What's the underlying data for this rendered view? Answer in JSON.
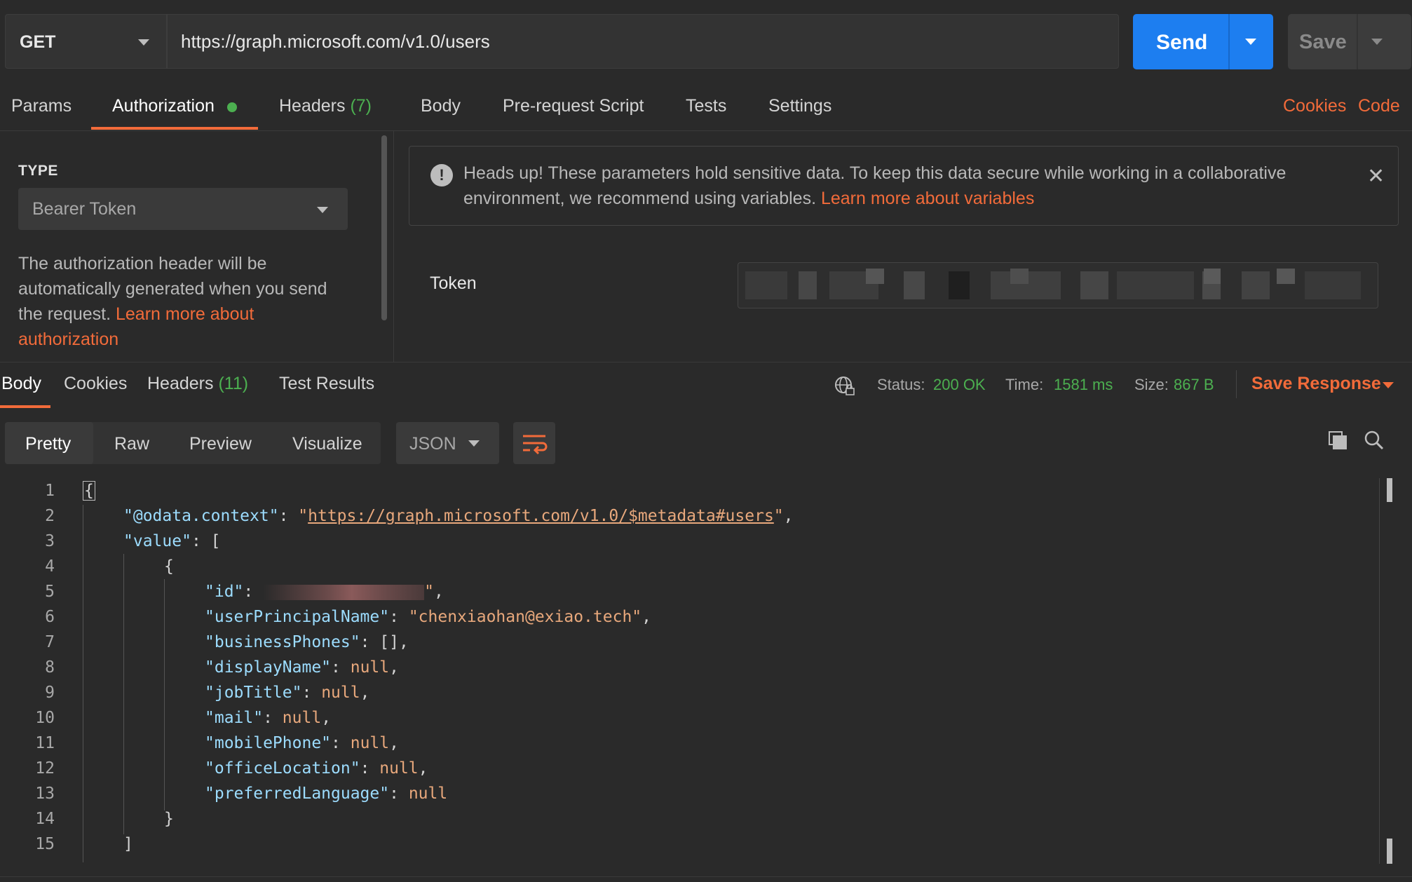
{
  "request": {
    "method": "GET",
    "url": "https://graph.microsoft.com/v1.0/users",
    "send_label": "Send",
    "save_label": "Save"
  },
  "request_tabs": [
    {
      "label": "Params"
    },
    {
      "label": "Authorization",
      "active": true
    },
    {
      "label": "Headers",
      "count": "(7)"
    },
    {
      "label": "Body"
    },
    {
      "label": "Pre-request Script"
    },
    {
      "label": "Tests"
    },
    {
      "label": "Settings"
    }
  ],
  "links": {
    "cookies": "Cookies",
    "code": "Code"
  },
  "auth": {
    "type_label": "TYPE",
    "type_value": "Bearer Token",
    "description": "The authorization header will be automatically generated when you send the request.",
    "description_link": "Learn more about authorization",
    "warning_text": "Heads up! These parameters hold sensitive data. To keep this data secure while working in a collaborative environment, we recommend using variables.",
    "warning_link": "Learn more about variables",
    "token_label": "Token"
  },
  "response_tabs": [
    {
      "label": "Body",
      "active": true
    },
    {
      "label": "Cookies"
    },
    {
      "label": "Headers",
      "count": "(11)"
    },
    {
      "label": "Test Results"
    }
  ],
  "response_meta": {
    "status_label": "Status:",
    "status_value": "200 OK",
    "time_label": "Time:",
    "time_value": "1581 ms",
    "size_label": "Size:",
    "size_value": "867 B",
    "save_response": "Save Response"
  },
  "view_modes": [
    "Pretty",
    "Raw",
    "Preview",
    "Visualize"
  ],
  "format": "JSON",
  "code_lines": [
    {
      "n": "1"
    },
    {
      "n": "2"
    },
    {
      "n": "3"
    },
    {
      "n": "4"
    },
    {
      "n": "5"
    },
    {
      "n": "6"
    },
    {
      "n": "7"
    },
    {
      "n": "8"
    },
    {
      "n": "9"
    },
    {
      "n": "10"
    },
    {
      "n": "11"
    },
    {
      "n": "12"
    },
    {
      "n": "13"
    },
    {
      "n": "14"
    },
    {
      "n": "15"
    }
  ],
  "json_body": {
    "context_key": "\"@odata.context\"",
    "context_val": "https://graph.microsoft.com/v1.0/$metadata#users",
    "value_key": "\"value\"",
    "id_key": "\"id\"",
    "upn_key": "\"userPrincipalName\"",
    "upn_val": "\"chenxiaohan@exiao.tech\"",
    "phones_key": "\"businessPhones\"",
    "displayName_key": "\"displayName\"",
    "jobTitle_key": "\"jobTitle\"",
    "mail_key": "\"mail\"",
    "mobilePhone_key": "\"mobilePhone\"",
    "officeLocation_key": "\"officeLocation\"",
    "preferredLanguage_key": "\"preferredLanguage\"",
    "null_val": "null"
  }
}
